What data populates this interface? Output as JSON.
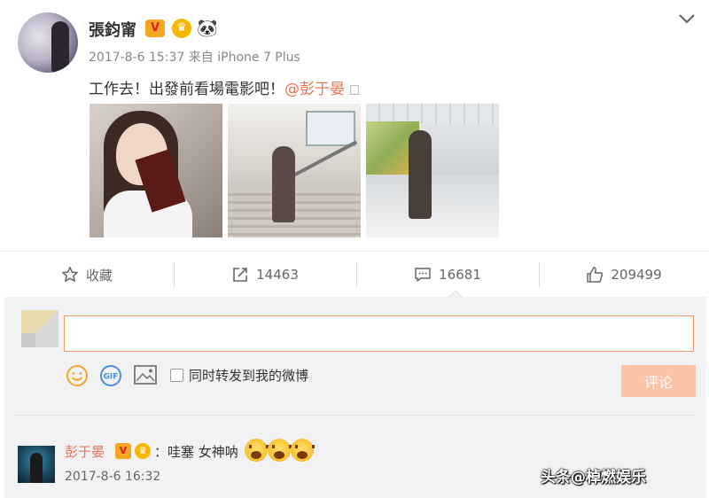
{
  "post": {
    "username": "張鈞甯",
    "verified_mark": "V",
    "timestamp": "2017-8-6 15:37",
    "source": "来自 iPhone 7 Plus",
    "text_main": "工作去！出發前看場電影吧！",
    "mention": "@彭于晏",
    "images": [
      {
        "alt": "photo-1"
      },
      {
        "alt": "photo-2"
      },
      {
        "alt": "photo-3"
      }
    ]
  },
  "actions": {
    "favorite_label": "收藏",
    "repost_count": "14463",
    "comment_count": "16681",
    "like_count": "209499"
  },
  "composer": {
    "input_value": "",
    "forward_label": "同时转发到我的微博",
    "submit_label": "评论",
    "gif_label": "GIF"
  },
  "comment": {
    "username": "彭于晏",
    "verified_mark": "V",
    "text": "：哇塞 女神呐",
    "timestamp": "2017-8-6 16:32"
  },
  "watermark": "头条@棹燃娱乐",
  "colors": {
    "accent": "#eb7350",
    "input_border": "#f09a6f",
    "submit_bg": "#fcc4a6",
    "panel_bg": "#f2f2f5"
  }
}
